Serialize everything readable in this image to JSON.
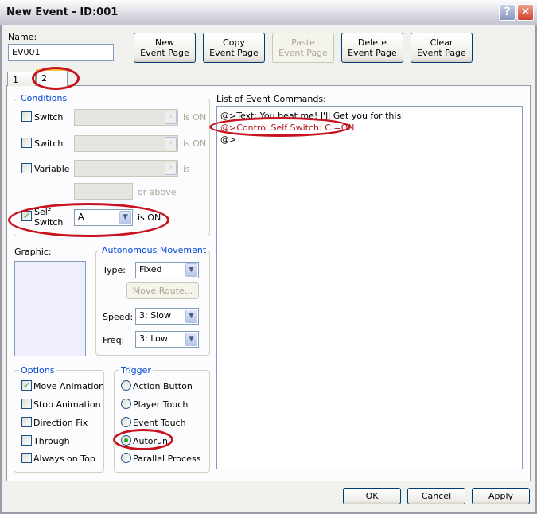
{
  "window": {
    "title": "New Event - ID:001",
    "help_icon": "?",
    "close_icon": "✕"
  },
  "name": {
    "label": "Name:",
    "value": "EV001"
  },
  "toolbar": {
    "new": "New\nEvent Page",
    "copy": "Copy\nEvent Page",
    "paste": "Paste\nEvent Page",
    "delete": "Delete\nEvent Page",
    "clear": "Clear\nEvent Page"
  },
  "tabs": [
    "1",
    "2"
  ],
  "conditions": {
    "title": "Conditions",
    "switch1": {
      "label": "Switch",
      "suffix": "is ON",
      "checked": false
    },
    "switch2": {
      "label": "Switch",
      "suffix": "is ON",
      "checked": false
    },
    "variable": {
      "label": "Variable",
      "suffix": "is",
      "checked": false
    },
    "or_above": "or above",
    "self_switch": {
      "label": "Self\nSwitch",
      "value": "A",
      "suffix": "is ON",
      "checked": true
    }
  },
  "commands": {
    "label": "List of Event Commands:",
    "lines": [
      "@>Text: You beat me! I'll Get you for this!",
      "@>Control Self Switch: C =ON",
      "@>"
    ],
    "highlight_color": "#c8141e"
  },
  "graphic": {
    "label": "Graphic:"
  },
  "movement": {
    "title": "Autonomous Movement",
    "type_label": "Type:",
    "type_value": "Fixed",
    "move_route": "Move Route...",
    "speed_label": "Speed:",
    "speed_value": "3: Slow",
    "freq_label": "Freq:",
    "freq_value": "3: Low"
  },
  "options": {
    "title": "Options",
    "items": [
      {
        "label": "Move Animation",
        "checked": true
      },
      {
        "label": "Stop Animation",
        "checked": false
      },
      {
        "label": "Direction Fix",
        "checked": false
      },
      {
        "label": "Through",
        "checked": false
      },
      {
        "label": "Always on Top",
        "checked": false
      }
    ]
  },
  "trigger": {
    "title": "Trigger",
    "items": [
      "Action Button",
      "Player Touch",
      "Event Touch",
      "Autorun",
      "Parallel Process"
    ],
    "selected": "Autorun"
  },
  "footer": {
    "ok": "OK",
    "cancel": "Cancel",
    "apply": "Apply"
  }
}
